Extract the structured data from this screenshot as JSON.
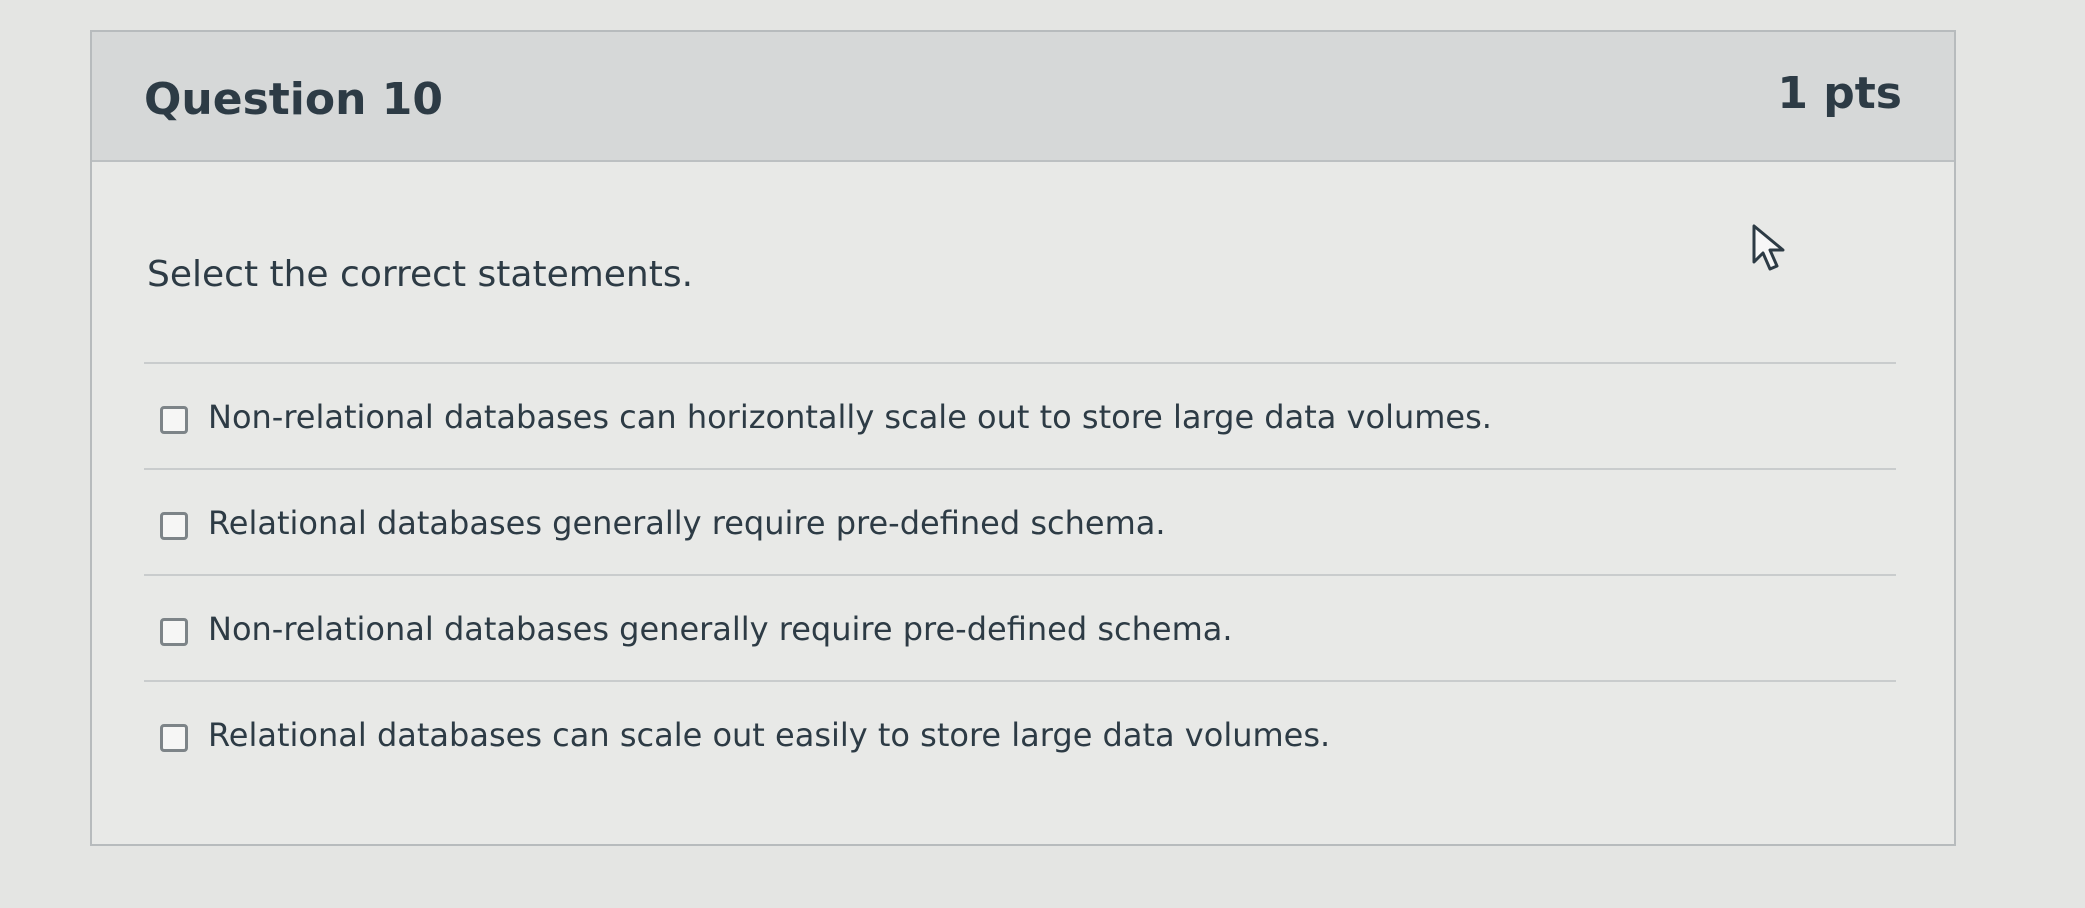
{
  "question": {
    "title": "Question 10",
    "points": "1 pts",
    "prompt": "Select the correct statements."
  },
  "answers": [
    {
      "label": "Non-relational databases can horizontally scale out to store large data volumes.",
      "checked": false
    },
    {
      "label": "Relational databases generally require pre-defined schema.",
      "checked": false
    },
    {
      "label": "Non-relational databases generally require pre-defined schema.",
      "checked": false
    },
    {
      "label": "Relational databases can scale out easily to store large data volumes.",
      "checked": false
    }
  ],
  "icons": {
    "cursor": "mouse-pointer-icon",
    "checkbox": "checkbox-unchecked-icon"
  },
  "colors": {
    "page_background": "#e4e5e3",
    "header_background": "#d6d8d8",
    "text": "#2d3b45",
    "border": "#b7bbbd"
  }
}
